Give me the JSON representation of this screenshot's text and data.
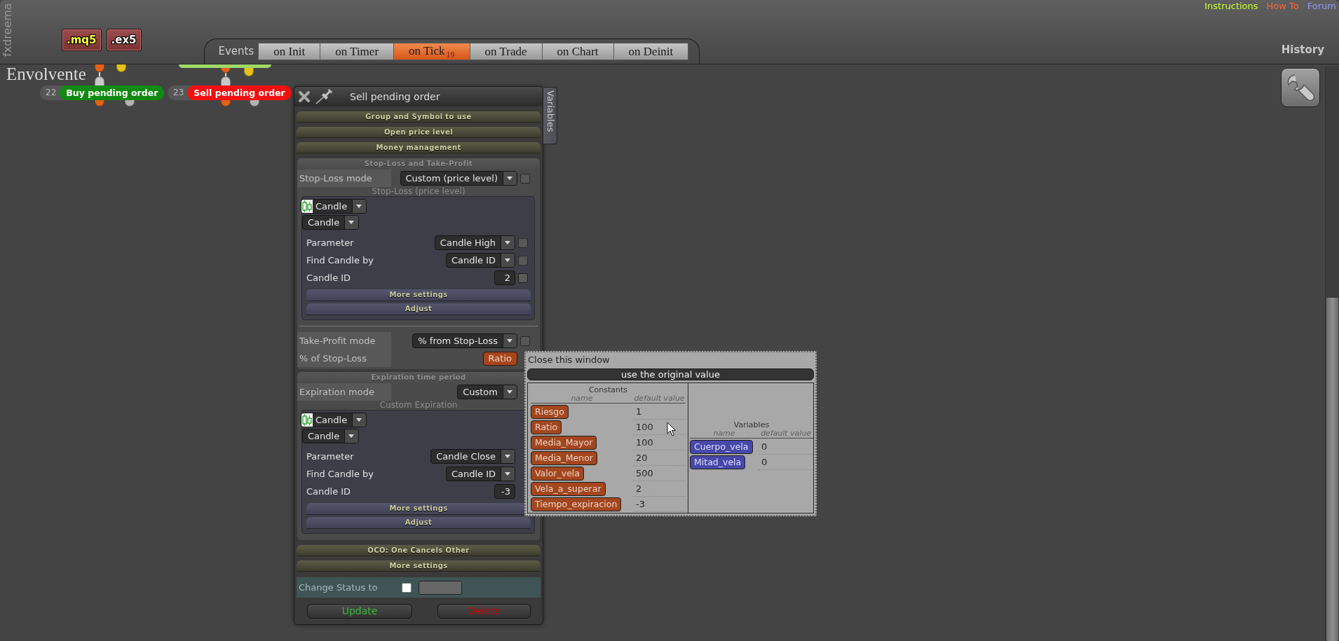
{
  "header": {
    "brand": "fxdreema",
    "file_buttons": [
      {
        "label": ".mq5",
        "kind": "source"
      },
      {
        "label": ".ex5",
        "kind": "binary"
      }
    ],
    "links": [
      {
        "label": "Instructions",
        "color": "#ccff33"
      },
      {
        "label": "How To",
        "color": "#ff6633"
      },
      {
        "label": "Forum",
        "color": "#9999ff"
      }
    ],
    "history": "History"
  },
  "events": {
    "label": "Events",
    "tabs": [
      {
        "label": "on Init",
        "selected": false
      },
      {
        "label": "on Timer",
        "selected": false
      },
      {
        "label": "on Tick",
        "count": "19",
        "selected": true
      },
      {
        "label": "on Trade",
        "selected": false
      },
      {
        "label": "on Chart",
        "selected": false
      },
      {
        "label": "on Deinit",
        "selected": false
      }
    ]
  },
  "canvas": {
    "title": "Envolvente",
    "nodes": [
      {
        "number": "22",
        "label": "Buy pending order",
        "color": "#108a10"
      },
      {
        "number": "23",
        "label": "Sell pending order",
        "color": "#f01010"
      }
    ]
  },
  "panel": {
    "title": "Sell pending order",
    "side_tab": "Variables",
    "sections": [
      {
        "kind": "bar",
        "title": "Group and Symbol to use"
      },
      {
        "kind": "bar",
        "title": "Open price level"
      },
      {
        "kind": "bar",
        "title": "Money management"
      },
      {
        "kind": "open",
        "title": "Stop-Loss and Take-Profit",
        "rows": [
          {
            "kind": "select",
            "label": "Stop-Loss mode",
            "value": "Custom (price level)",
            "checked": false
          },
          {
            "kind": "group",
            "caption": "Stop-Loss (price level)",
            "source": "Candle",
            "subtype": "Candle",
            "rows": [
              {
                "kind": "select",
                "label": "Parameter",
                "value": "Candle High",
                "checked": false
              },
              {
                "kind": "select",
                "label": "Find Candle by",
                "value": "Candle ID",
                "checked": false
              },
              {
                "kind": "input",
                "label": "Candle ID",
                "value": "2",
                "checked": false
              }
            ],
            "buttons": [
              "More settings",
              "Adjust"
            ]
          },
          {
            "kind": "divider"
          },
          {
            "kind": "select",
            "label": "Take-Profit mode",
            "value": "% from Stop-Loss",
            "checked": false
          },
          {
            "kind": "constant",
            "label": "% of Stop-Loss",
            "value": "Ratio"
          }
        ]
      },
      {
        "kind": "open",
        "title": "Expiration time period",
        "rows": [
          {
            "kind": "select",
            "label": "Expiration mode",
            "value": "Custom"
          },
          {
            "kind": "group",
            "caption": "Custom Expiration",
            "source": "Candle",
            "subtype": "Candle",
            "rows": [
              {
                "kind": "select",
                "label": "Parameter",
                "value": "Candle Close"
              },
              {
                "kind": "select",
                "label": "Find Candle by",
                "value": "Candle ID"
              },
              {
                "kind": "input",
                "label": "Candle ID",
                "value": "-3"
              }
            ],
            "buttons": [
              "More settings",
              "Adjust"
            ]
          }
        ]
      },
      {
        "kind": "bar",
        "title": "OCO: One Cancels Other"
      },
      {
        "kind": "bar",
        "title": "More settings"
      }
    ],
    "status": {
      "label": "Change Status to",
      "checked": false
    },
    "buttons": [
      {
        "label": "Update",
        "kind": "update"
      },
      {
        "label": "Delete",
        "kind": "delete"
      }
    ]
  },
  "popup": {
    "close": "Close this window",
    "reset": "use the original value",
    "tables": [
      {
        "kind": "constant",
        "title": "Constants",
        "columns": [
          "name",
          "default value"
        ],
        "rows": [
          {
            "name": "Riesgo",
            "value": "1"
          },
          {
            "name": "Ratio",
            "value": "100"
          },
          {
            "name": "Media_Mayor",
            "value": "100"
          },
          {
            "name": "Media_Menor",
            "value": "20"
          },
          {
            "name": "Valor_vela",
            "value": "500"
          },
          {
            "name": "Vela_a_superar",
            "value": "2"
          },
          {
            "name": "Tiempo_expiracion",
            "value": "-3"
          }
        ]
      },
      {
        "kind": "variable",
        "title": "Variables",
        "columns": [
          "name",
          "default value"
        ],
        "rows": [
          {
            "name": "Cuerpo_vela",
            "value": "0"
          },
          {
            "name": "Mitad_vela",
            "value": "0"
          }
        ]
      }
    ]
  }
}
